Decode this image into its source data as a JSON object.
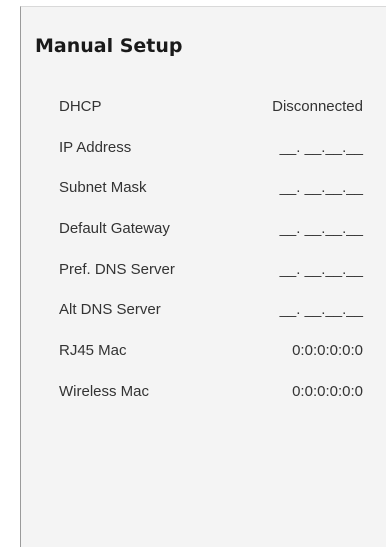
{
  "panel": {
    "title": "Manual Setup"
  },
  "rows": [
    {
      "label": "DHCP",
      "value": "Disconnected"
    },
    {
      "label": "IP Address",
      "value": "__. __.__.__"
    },
    {
      "label": "Subnet Mask",
      "value": "__. __.__.__"
    },
    {
      "label": "Default Gateway",
      "value": "__. __.__.__"
    },
    {
      "label": "Pref. DNS Server",
      "value": "__. __.__.__"
    },
    {
      "label": "Alt DNS Server",
      "value": "__. __.__.__"
    },
    {
      "label": "RJ45 Mac",
      "value": "0:0:0:0:0:0"
    },
    {
      "label": "Wireless Mac",
      "value": "0:0:0:0:0:0"
    }
  ]
}
